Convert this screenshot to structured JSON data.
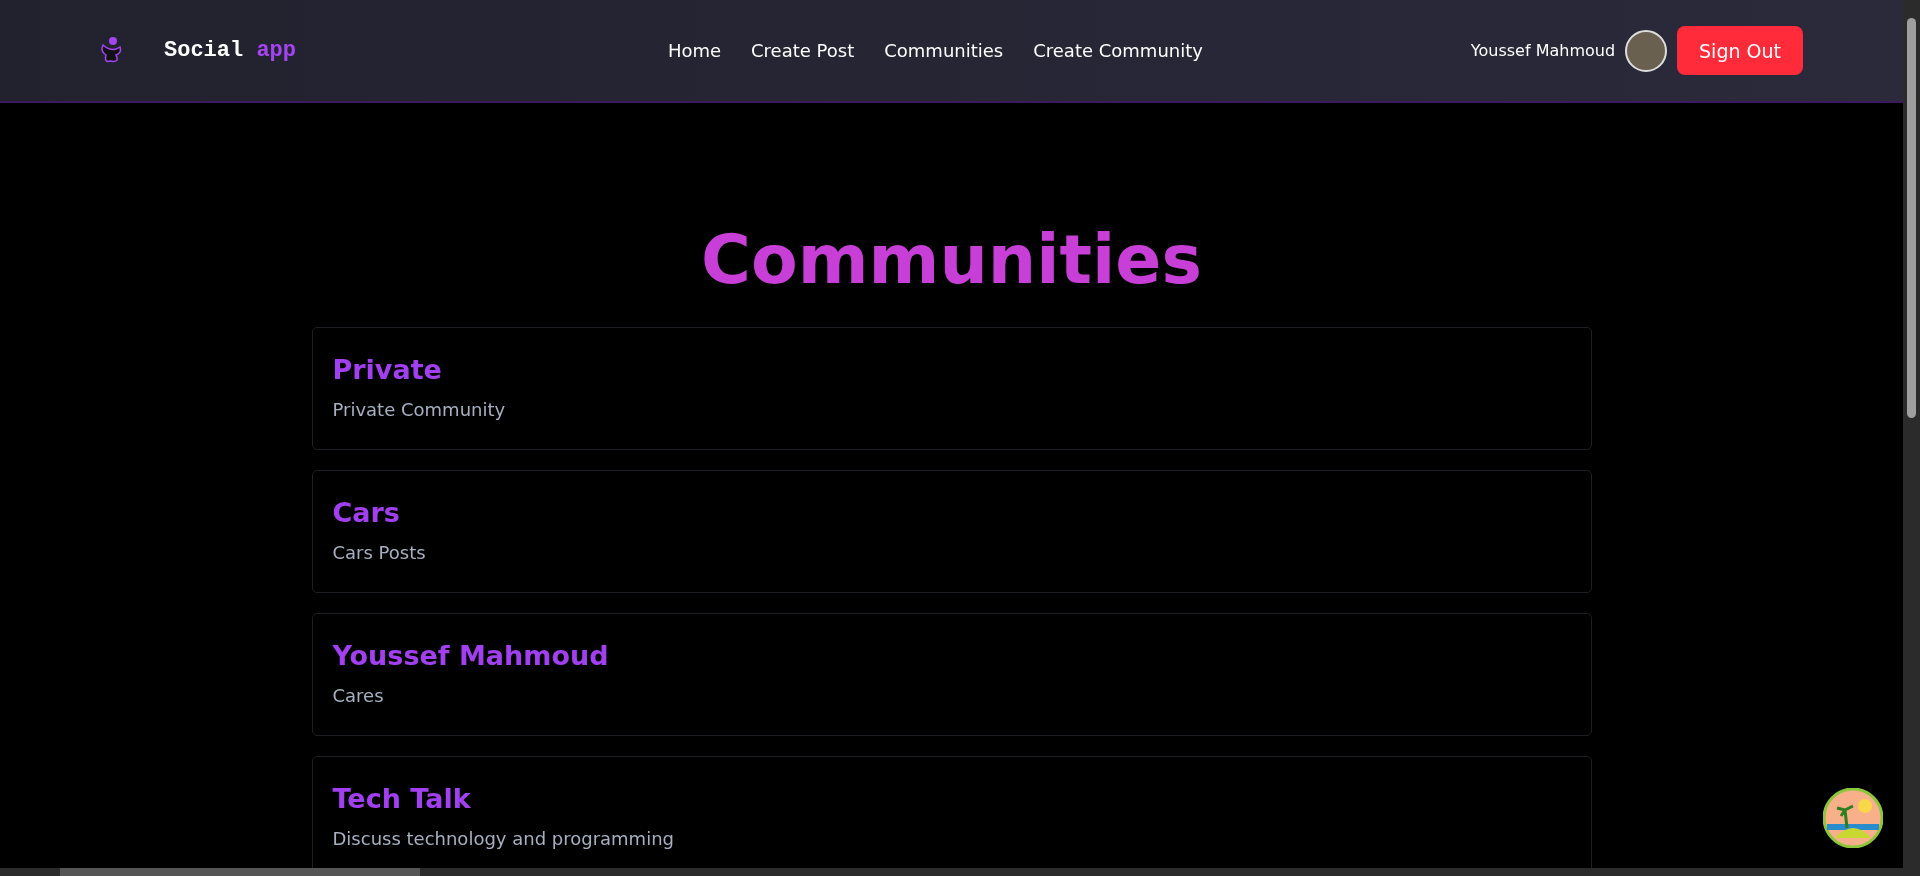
{
  "brand": {
    "name": "Social",
    "accent": "app"
  },
  "nav": [
    {
      "label": "Home"
    },
    {
      "label": "Create Post"
    },
    {
      "label": "Communities"
    },
    {
      "label": "Create Community"
    }
  ],
  "user": {
    "name": "Youssef Mahmoud"
  },
  "sign_out": "Sign Out",
  "page_title": "Communities",
  "communities": [
    {
      "name": "Private",
      "description": "Private Community"
    },
    {
      "name": "Cars",
      "description": "Cars Posts"
    },
    {
      "name": "Youssef Mahmoud",
      "description": "Cares"
    },
    {
      "name": "Tech Talk",
      "description": "Discuss technology and programming"
    }
  ]
}
